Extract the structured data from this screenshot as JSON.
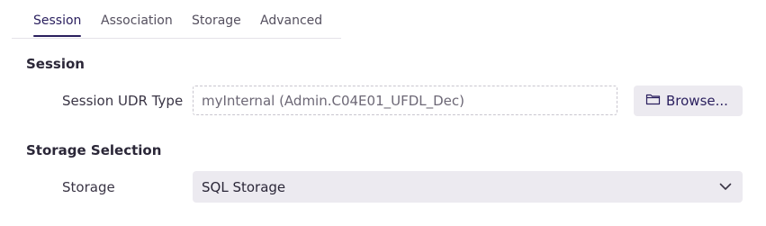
{
  "tabs": [
    {
      "label": "Session",
      "active": true
    },
    {
      "label": "Association",
      "active": false
    },
    {
      "label": "Storage",
      "active": false
    },
    {
      "label": "Advanced",
      "active": false
    }
  ],
  "session_section": {
    "heading": "Session",
    "udr_type_label": "Session UDR Type",
    "udr_type_value": "myInternal (Admin.C04E01_UFDL_Dec)",
    "browse_label": "Browse...",
    "browse_icon": "folder-icon"
  },
  "storage_section": {
    "heading": "Storage Selection",
    "storage_label": "Storage",
    "storage_value": "SQL Storage",
    "dropdown_icon": "chevron-down-icon"
  },
  "colors": {
    "accent": "#2a1f5e",
    "control_background": "#eceaf0",
    "dashed_border": "#c9c6cf"
  }
}
